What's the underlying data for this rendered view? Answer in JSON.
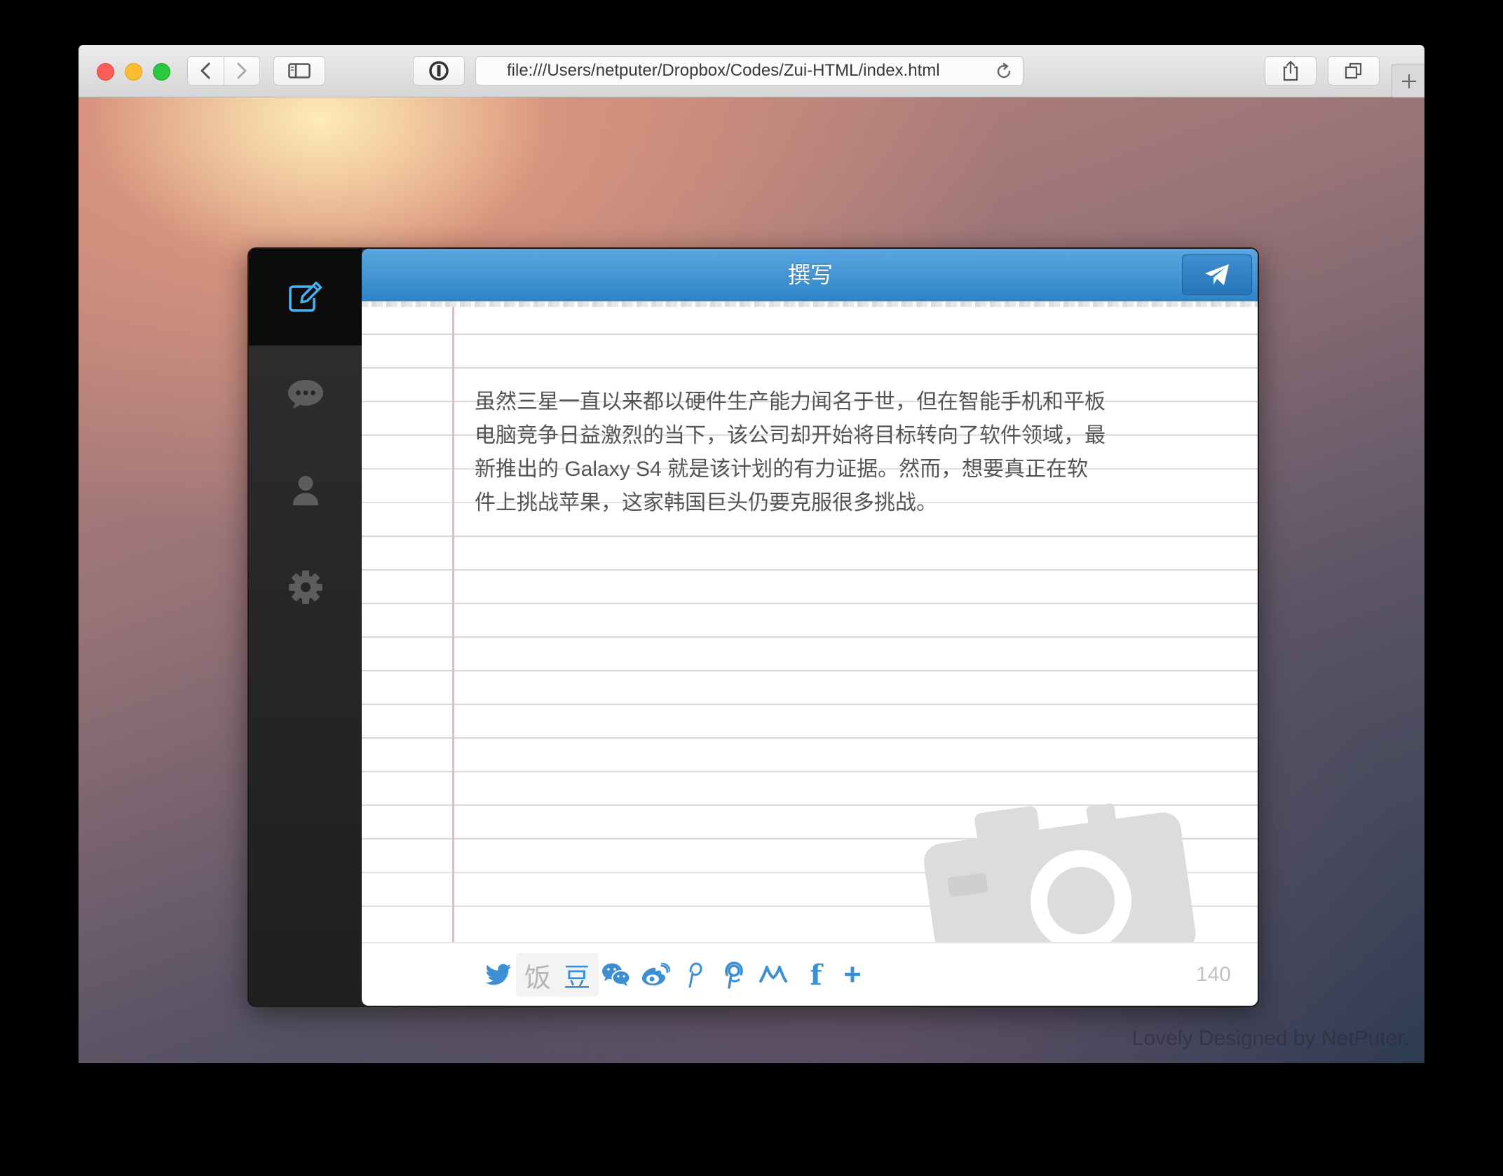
{
  "browser": {
    "url": "file:///Users/netputer/Dropbox/Codes/Zui-HTML/index.html",
    "icons": [
      "back-icon",
      "forward-icon",
      "sidebar-icon",
      "onepassword-icon",
      "reload-icon",
      "share-icon",
      "tabs-icon",
      "plus-icon"
    ]
  },
  "app": {
    "title": "撰写",
    "sidebar": [
      {
        "name": "compose",
        "icon": "edit-icon",
        "active": true
      },
      {
        "name": "messages",
        "icon": "chat-bubble-icon",
        "active": false
      },
      {
        "name": "profile",
        "icon": "user-icon",
        "active": false
      },
      {
        "name": "settings",
        "icon": "gear-icon",
        "active": false
      }
    ],
    "note": {
      "lines": [
        "虽然三星一直以来都以硬件生产能力闻名于世，但在智能手机和平板",
        "电脑竞争日益激烈的当下，该公司却开始将目标转向了软件领域，最",
        "新推出的 Galaxy S4 就是该计划的有力证据。然而，想要真正在软",
        "件上挑战苹果，这家韩国巨头仍要克服很多挑战。"
      ]
    },
    "share": {
      "fanfou_label": "饭",
      "douban_label": "豆",
      "facebook_label": "f",
      "more_label": "+",
      "icons": [
        "twitter-icon",
        "fanfou-icon",
        "douban-icon",
        "wechat-icon",
        "weibo-icon",
        "pinterest-icon",
        "tencent-weibo-icon",
        "renren-icon",
        "facebook-icon",
        "plus-icon"
      ]
    },
    "char_count": "140"
  },
  "footer": "Lovely Designed by NetPuter.",
  "colors": {
    "accent": "#3c8fd2",
    "header_top": "#5aa7e0",
    "header_bottom": "#2d84c6",
    "margin_line": "#f1b3b3"
  }
}
